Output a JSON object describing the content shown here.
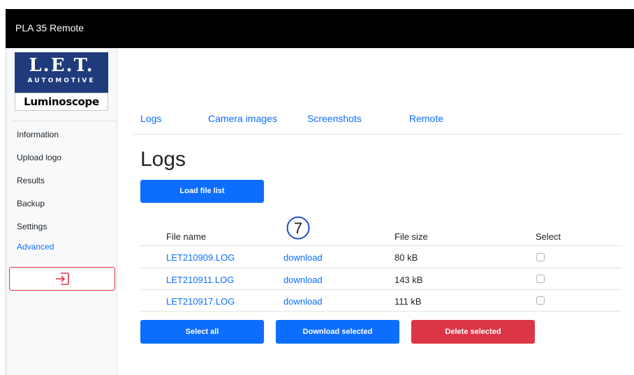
{
  "app": {
    "title": "PLA 35 Remote"
  },
  "logo": {
    "brand_line1": "L.E.T.",
    "brand_line2": "AUTOMOTIVE",
    "brand_line3": "Luminoscope"
  },
  "sidebar": {
    "items": [
      {
        "label": "Information",
        "active": false
      },
      {
        "label": "Upload logo",
        "active": false
      },
      {
        "label": "Results",
        "active": false
      },
      {
        "label": "Backup",
        "active": false
      },
      {
        "label": "Settings",
        "active": false
      },
      {
        "label": "Advanced",
        "active": true
      }
    ],
    "logout_icon": "logout-arrow-icon"
  },
  "tabs": [
    {
      "label": "Logs"
    },
    {
      "label": "Camera images"
    },
    {
      "label": "Screenshots"
    },
    {
      "label": "Remote"
    }
  ],
  "main": {
    "heading": "Logs",
    "load_button": "Load file list",
    "step_marker": "7"
  },
  "table": {
    "headers": {
      "file_name": "File name",
      "action": "",
      "file_size": "File size",
      "select": "Select"
    },
    "rows": [
      {
        "name": "LET210909.LOG",
        "action": "download",
        "size": "80 kB",
        "selected": false
      },
      {
        "name": "LET210911.LOG",
        "action": "download",
        "size": "143 kB",
        "selected": false
      },
      {
        "name": "LET210917.LOG",
        "action": "download",
        "size": "111 kB",
        "selected": false
      }
    ]
  },
  "actions": {
    "select_all": "Select all",
    "download_selected": "Download selected",
    "delete_selected": "Delete selected"
  },
  "colors": {
    "primary": "#0d6efd",
    "danger": "#dc3545",
    "topbar": "#000000",
    "logo_blue": "#1f3b7c"
  }
}
